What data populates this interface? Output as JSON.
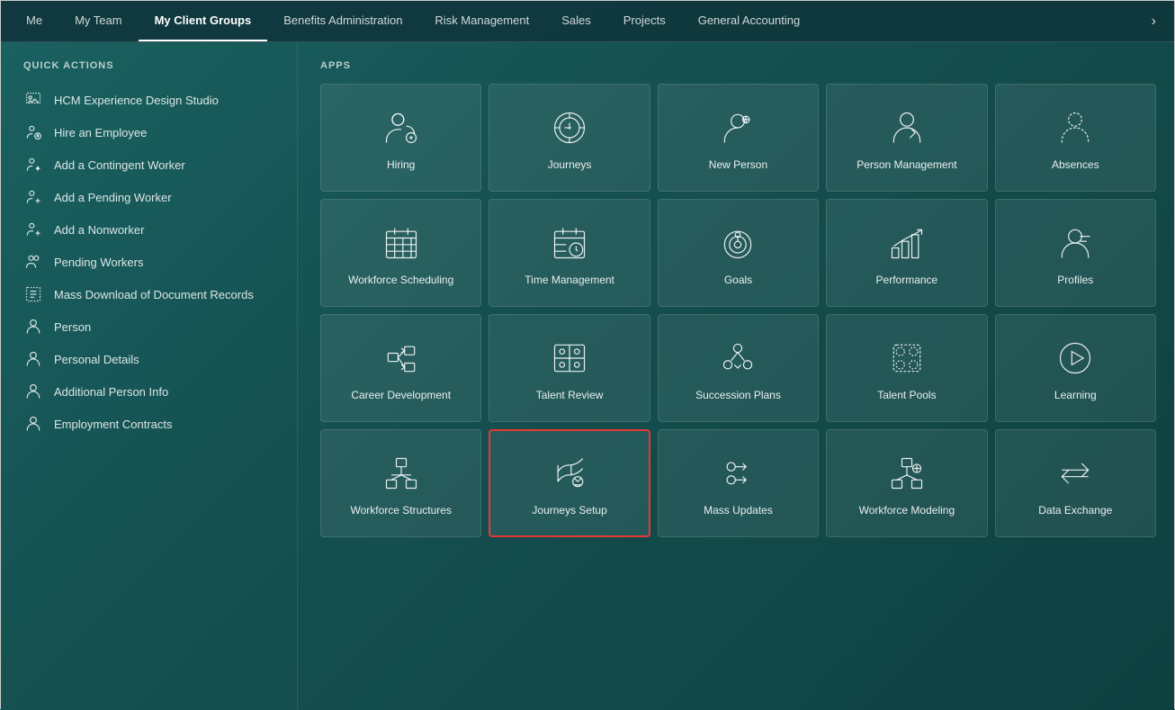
{
  "nav": {
    "items": [
      {
        "id": "me",
        "label": "Me",
        "active": false
      },
      {
        "id": "my-team",
        "label": "My Team",
        "active": false
      },
      {
        "id": "my-client-groups",
        "label": "My Client Groups",
        "active": true
      },
      {
        "id": "benefits-administration",
        "label": "Benefits Administration",
        "active": false
      },
      {
        "id": "risk-management",
        "label": "Risk Management",
        "active": false
      },
      {
        "id": "sales",
        "label": "Sales",
        "active": false
      },
      {
        "id": "projects",
        "label": "Projects",
        "active": false
      },
      {
        "id": "general-accounting",
        "label": "General Accounting",
        "active": false
      }
    ],
    "more_icon": "›"
  },
  "sidebar": {
    "section_title": "QUICK ACTIONS",
    "items": [
      {
        "id": "hcm-experience",
        "label": "HCM Experience Design Studio"
      },
      {
        "id": "hire-employee",
        "label": "Hire an Employee"
      },
      {
        "id": "add-contingent",
        "label": "Add a Contingent Worker"
      },
      {
        "id": "add-pending",
        "label": "Add a Pending Worker"
      },
      {
        "id": "add-nonworker",
        "label": "Add a Nonworker"
      },
      {
        "id": "pending-workers",
        "label": "Pending Workers"
      },
      {
        "id": "mass-download",
        "label": "Mass Download of Document Records"
      },
      {
        "id": "person",
        "label": "Person"
      },
      {
        "id": "personal-details",
        "label": "Personal Details"
      },
      {
        "id": "additional-person-info",
        "label": "Additional Person Info"
      },
      {
        "id": "employment-contracts",
        "label": "Employment Contracts"
      }
    ]
  },
  "apps": {
    "section_title": "APPS",
    "tiles": [
      {
        "id": "hiring",
        "label": "Hiring",
        "icon": "hiring",
        "highlighted": false
      },
      {
        "id": "journeys",
        "label": "Journeys",
        "icon": "journeys",
        "highlighted": false
      },
      {
        "id": "new-person",
        "label": "New Person",
        "icon": "new-person",
        "highlighted": false
      },
      {
        "id": "person-management",
        "label": "Person Management",
        "icon": "person-management",
        "highlighted": false
      },
      {
        "id": "absences",
        "label": "Absences",
        "icon": "absences",
        "highlighted": false
      },
      {
        "id": "workforce-scheduling",
        "label": "Workforce Scheduling",
        "icon": "workforce-scheduling",
        "highlighted": false
      },
      {
        "id": "time-management",
        "label": "Time Management",
        "icon": "time-management",
        "highlighted": false
      },
      {
        "id": "goals",
        "label": "Goals",
        "icon": "goals",
        "highlighted": false
      },
      {
        "id": "performance",
        "label": "Performance",
        "icon": "performance",
        "highlighted": false
      },
      {
        "id": "profiles",
        "label": "Profiles",
        "icon": "profiles",
        "highlighted": false
      },
      {
        "id": "career-development",
        "label": "Career Development",
        "icon": "career-development",
        "highlighted": false
      },
      {
        "id": "talent-review",
        "label": "Talent Review",
        "icon": "talent-review",
        "highlighted": false
      },
      {
        "id": "succession-plans",
        "label": "Succession Plans",
        "icon": "succession-plans",
        "highlighted": false
      },
      {
        "id": "talent-pools",
        "label": "Talent Pools",
        "icon": "talent-pools",
        "highlighted": false
      },
      {
        "id": "learning",
        "label": "Learning",
        "icon": "learning",
        "highlighted": false
      },
      {
        "id": "workforce-structures",
        "label": "Workforce Structures",
        "icon": "workforce-structures",
        "highlighted": false
      },
      {
        "id": "journeys-setup",
        "label": "Journeys Setup",
        "icon": "journeys-setup",
        "highlighted": true
      },
      {
        "id": "mass-updates",
        "label": "Mass Updates",
        "icon": "mass-updates",
        "highlighted": false
      },
      {
        "id": "workforce-modeling",
        "label": "Workforce Modeling",
        "icon": "workforce-modeling",
        "highlighted": false
      },
      {
        "id": "data-exchange",
        "label": "Data Exchange",
        "icon": "data-exchange",
        "highlighted": false
      }
    ]
  }
}
